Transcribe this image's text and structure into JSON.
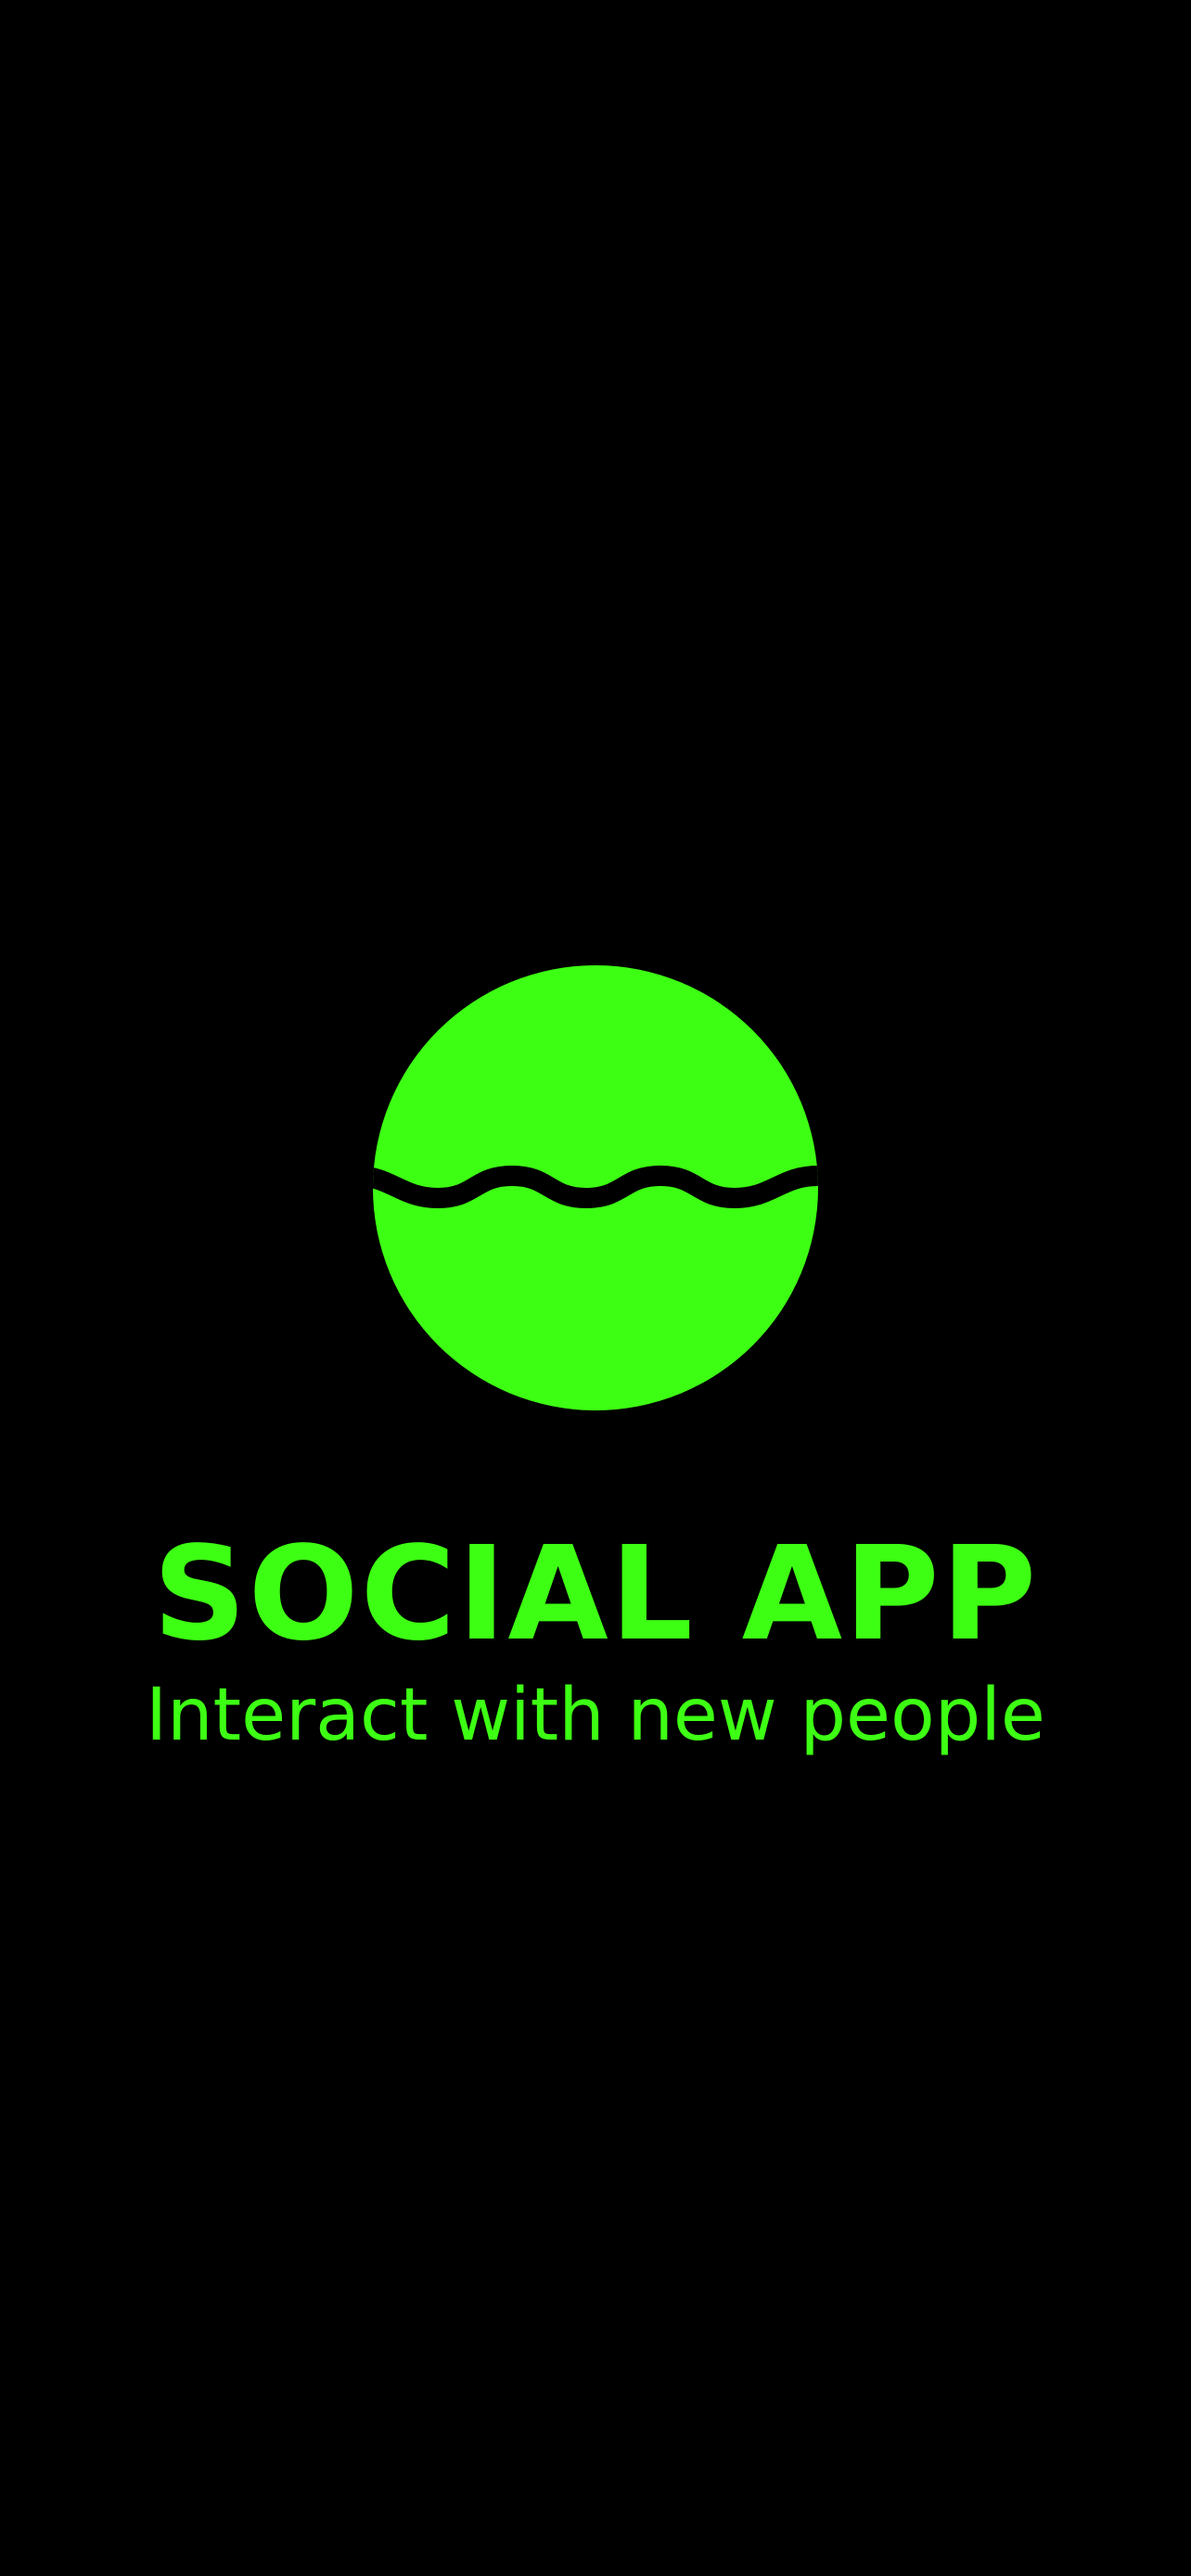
{
  "screen": "splash",
  "app": {
    "title": "SOCIAL APP",
    "tagline": "Interact with new people"
  },
  "logo": {
    "icon": "wave-globe-icon"
  },
  "colors": {
    "background": "#000000",
    "accent": "#3dff14"
  }
}
